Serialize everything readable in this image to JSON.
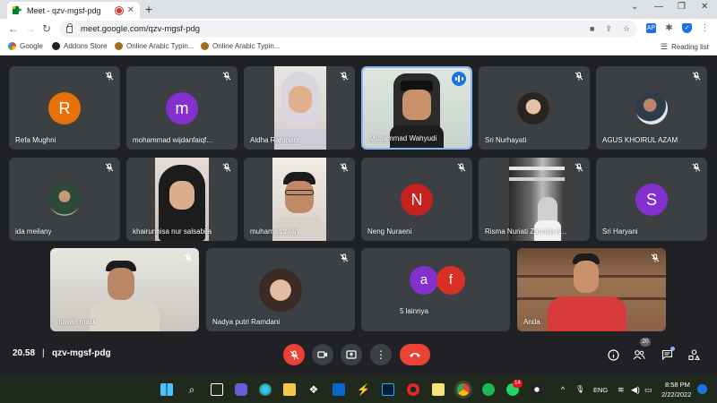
{
  "browser": {
    "tab_title": "Meet - qzv-mgsf-pdg",
    "url": "meet.google.com/qzv-mgsf-pdg",
    "bookmarks": [
      "Google",
      "Addons Store",
      "Online Arabic Typin...",
      "Online Arabic Typin..."
    ],
    "reading_list": "Reading list",
    "ext_label": "AP"
  },
  "participants": [
    {
      "name": "Refa Mughni",
      "initial": "R",
      "color": "#e8710a"
    },
    {
      "name": "mohammad wijdanfaiqf...",
      "initial": "m",
      "color": "#8430ce"
    },
    {
      "name": "Aldha Rahmani"
    },
    {
      "name": "Muhammad Wahyudi"
    },
    {
      "name": "Sri Nurhayati"
    },
    {
      "name": "AGUS KHOIRUL AZAM"
    },
    {
      "name": "ida meilany"
    },
    {
      "name": "khairunnisa nur salsabila"
    },
    {
      "name": "muhamad zilan"
    },
    {
      "name": "Neng Nuraeni",
      "initial": "N",
      "color": "#c5221f"
    },
    {
      "name": "Risma Nuriati Zannah A..."
    },
    {
      "name": "Sri Haryani",
      "initial": "S",
      "color": "#8430ce"
    },
    {
      "name": "ridwan malik"
    },
    {
      "name": "Nadya putri Ramdani"
    },
    {
      "name": "5 lainnya",
      "avatars": [
        {
          "initial": "a",
          "color": "#8430ce"
        },
        {
          "initial": "f",
          "color": "#d93025"
        }
      ]
    },
    {
      "name": "Anda"
    }
  ],
  "meeting": {
    "time": "20.58",
    "separator": "|",
    "code": "qzv-mgsf-pdg",
    "participant_count": "20"
  },
  "taskbar": {
    "lang": "ENG",
    "clock_time": "8:58 PM",
    "clock_date": "2/22/2022",
    "whatsapp_badge": "14"
  }
}
